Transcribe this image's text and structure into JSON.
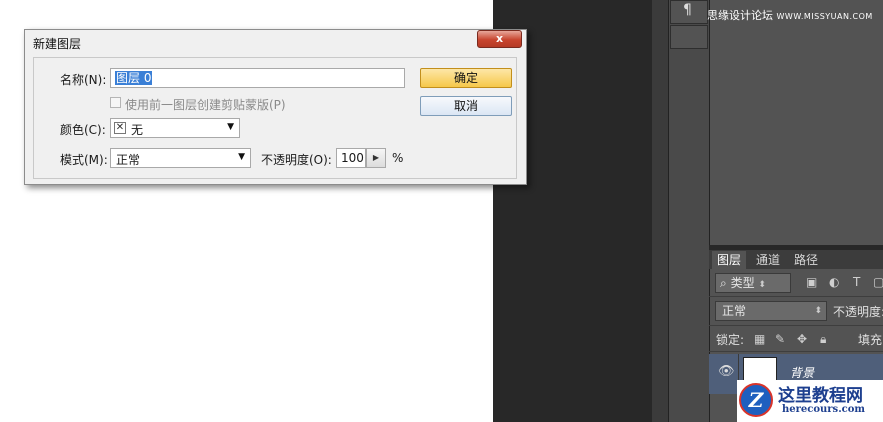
{
  "dialog": {
    "title": "新建图层",
    "close_label": "x",
    "name_label": "名称(N):",
    "name_value": "图层 0",
    "clip_label": "使用前一图层创建剪贴蒙版(P)",
    "color_label": "颜色(C):",
    "color_value": "无",
    "mode_label": "模式(M):",
    "mode_value": "正常",
    "opacity_label": "不透明度(O):",
    "opacity_value": "100",
    "opacity_unit": "%",
    "ok_label": "确定",
    "cancel_label": "取消",
    "clip_checked": false,
    "clip_enabled": false
  },
  "watermark": {
    "cn": "思缘设计论坛",
    "url": "WWW.MISSYUAN.COM"
  },
  "layers_panel": {
    "tabs": [
      "图层",
      "通道",
      "路径"
    ],
    "filter_value": "类型",
    "blend_value": "正常",
    "opacity_label": "不透明度:",
    "lock_label": "锁定:",
    "fill_label": "填充",
    "layer_name": "背景"
  },
  "logo": {
    "title": "这里教程网",
    "subtitle": "herecours.com",
    "badge": "Z"
  },
  "colors": {
    "workspace_bg": "#282828",
    "panel_bg": "#535353",
    "ok_button": "#f6c84a",
    "selection": "#3a7fd6",
    "layer_selected": "#4f5f7a",
    "logo_blue": "#1d3f8f"
  }
}
